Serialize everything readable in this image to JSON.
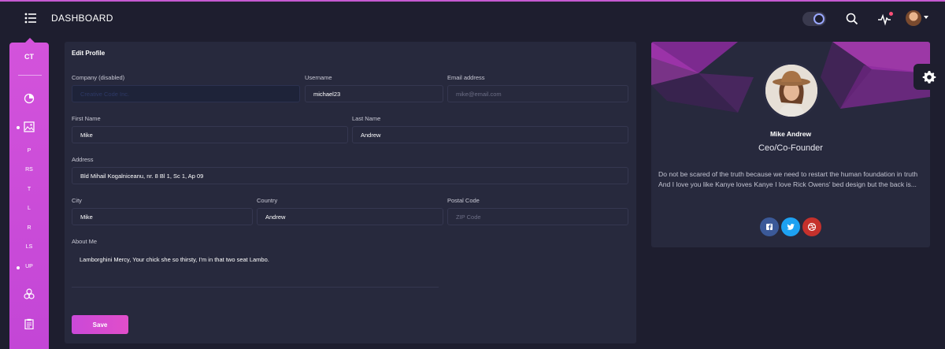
{
  "navbar": {
    "brand": "DASHBOARD",
    "icons": [
      "menu-icon",
      "theme-toggle",
      "search-icon",
      "activity-icon",
      "avatar"
    ]
  },
  "sidebar": {
    "logo": "CT",
    "items": [
      {
        "label": "P"
      },
      {
        "label": "RS"
      },
      {
        "label": "T"
      },
      {
        "label": "L"
      },
      {
        "label": "R"
      },
      {
        "label": "LS"
      },
      {
        "label": "UP"
      }
    ],
    "icons": [
      "chart-pie-icon",
      "image-icon",
      "atom-icon",
      "clipboard-icon"
    ]
  },
  "edit_profile": {
    "title": "Edit Profile",
    "company_label": "Company (disabled)",
    "company_placeholder": "Creative Code Inc.",
    "username_label": "Username",
    "username_value": "michael23",
    "email_label": "Email address",
    "email_placeholder": "mike@email.com",
    "firstname_label": "First Name",
    "firstname_value": "Mike",
    "lastname_label": "Last Name",
    "lastname_value": "Andrew",
    "address_label": "Address",
    "address_value": "Bld Mihail Kogalniceanu, nr. 8 Bl 1, Sc 1, Ap 09",
    "city_label": "City",
    "city_value": "Mike",
    "country_label": "Country",
    "country_value": "Andrew",
    "postal_label": "Postal Code",
    "postal_placeholder": "ZIP Code",
    "about_label": "About Me",
    "about_value": "Lamborghini Mercy, Your chick she so thirsty, I'm in that two seat Lambo.",
    "save_label": "Save"
  },
  "user_card": {
    "name": "Mike Andrew",
    "role": "Ceo/Co-Founder",
    "description": "Do not be scared of the truth because we need to restart the human foundation in truth And I love you like Kanye loves Kanye I love Rick Owens' bed design but the back is...",
    "social": [
      "facebook-icon",
      "twitter-icon",
      "dribbble-icon"
    ]
  },
  "colors": {
    "accent": "#e14eca",
    "sidebar": "#d353db",
    "card": "#27293d",
    "background": "#1e1e2f",
    "facebook": "#3b5998",
    "twitter": "#1da1f2",
    "dribbble": "#c5312c"
  }
}
